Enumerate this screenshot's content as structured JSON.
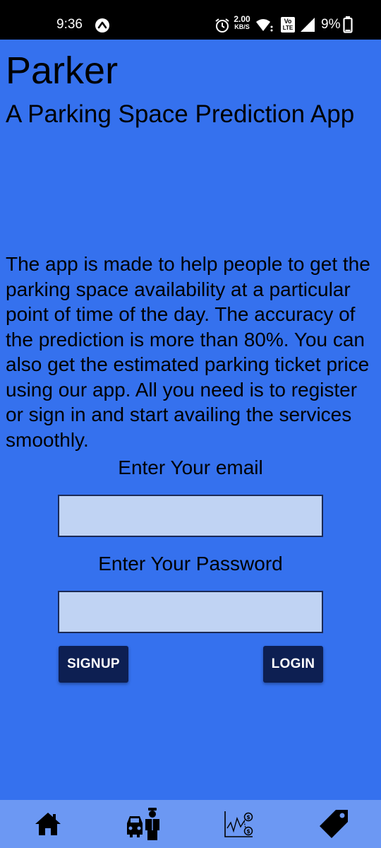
{
  "status_bar": {
    "time": "9:36",
    "network_speed_top": "2.00",
    "network_speed_bottom": "KB/S",
    "volte_top": "Vo",
    "volte_bottom": "LTE",
    "battery": "9%"
  },
  "app": {
    "title": "Parker",
    "subtitle": "A Parking Space Prediction App",
    "description": "The app is made to help people to get the parking space availability at a particular point of time of the day. The accuracy of the prediction is more than 80%. You can also get the estimated parking ticket price using our app. All you need is to register or sign in and start availing the services smoothly."
  },
  "form": {
    "email_label": "Enter Your email",
    "email_value": "",
    "password_label": "Enter Your Password",
    "password_value": "",
    "signup_label": "SIGNUP",
    "login_label": "LOGIN"
  },
  "bottom_nav": {
    "items": [
      {
        "icon": "home-icon"
      },
      {
        "icon": "parking-attendant-icon"
      },
      {
        "icon": "price-chart-icon"
      },
      {
        "icon": "price-tag-icon"
      }
    ]
  },
  "colors": {
    "background": "#3571ee",
    "input_fill": "#c0d3f3",
    "button": "#0d1f52",
    "bottom_nav": "#6c98f3"
  }
}
